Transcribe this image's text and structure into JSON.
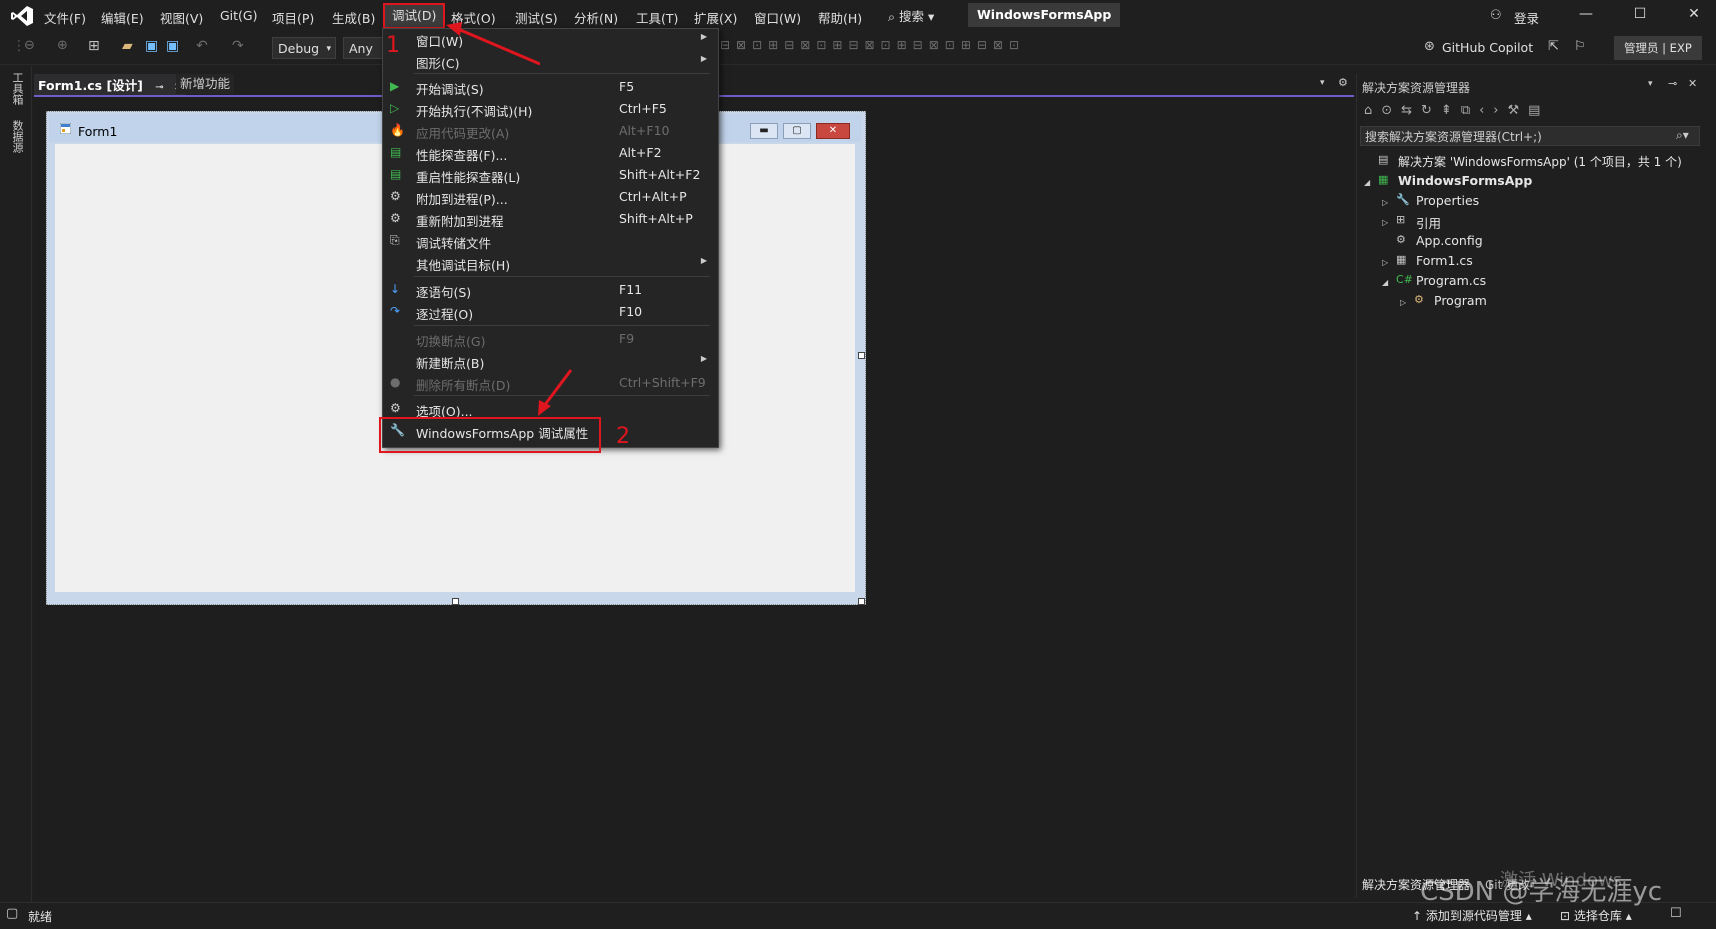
{
  "app": {
    "project_title": "WindowsFormsApp",
    "login_label": "登录",
    "search_label": "搜索"
  },
  "menu": {
    "items": [
      "文件(F)",
      "编辑(E)",
      "视图(V)",
      "Git(G)",
      "项目(P)",
      "生成(B)",
      "调试(D)",
      "格式(O)",
      "测试(S)",
      "分析(N)",
      "工具(T)",
      "扩展(X)",
      "窗口(W)",
      "帮助(H)"
    ],
    "active_item": "调试(D)"
  },
  "toolbar": {
    "config_combo": "Debug",
    "platform_combo": "Any C",
    "copilot_label": "GitHub Copilot",
    "admin_badge": "管理员 | EXP"
  },
  "left_bar": {
    "toolbox_label": "工具箱",
    "datasource_label": "数据源"
  },
  "tabs": {
    "active": "Form1.cs [设计]",
    "pin_glyph": "⊸",
    "close_glyph": "✕",
    "other": "新增功能"
  },
  "form": {
    "title": "Form1"
  },
  "debug_menu": {
    "items": [
      {
        "label": "窗口(W)",
        "shortcut": "",
        "submenu": true,
        "disabled": false,
        "icon": "none"
      },
      {
        "label": "图形(C)",
        "shortcut": "",
        "submenu": true,
        "disabled": false,
        "icon": "none"
      },
      {
        "label": "开始调试(S)",
        "shortcut": "F5",
        "submenu": false,
        "disabled": false,
        "icon": "play-filled-icon"
      },
      {
        "label": "开始执行(不调试)(H)",
        "shortcut": "Ctrl+F5",
        "submenu": false,
        "disabled": false,
        "icon": "play-outline-icon"
      },
      {
        "label": "应用代码更改(A)",
        "shortcut": "Alt+F10",
        "submenu": false,
        "disabled": true,
        "icon": "flame-icon"
      },
      {
        "label": "性能探查器(F)...",
        "shortcut": "Alt+F2",
        "submenu": false,
        "disabled": false,
        "icon": "performance-icon"
      },
      {
        "label": "重启性能探查器(L)",
        "shortcut": "Shift+Alt+F2",
        "submenu": false,
        "disabled": false,
        "icon": "performance-restart-icon"
      },
      {
        "label": "附加到进程(P)...",
        "shortcut": "Ctrl+Alt+P",
        "submenu": false,
        "disabled": false,
        "icon": "attach-icon"
      },
      {
        "label": "重新附加到进程",
        "shortcut": "Shift+Alt+P",
        "submenu": false,
        "disabled": false,
        "icon": "reattach-icon"
      },
      {
        "label": "调试转储文件",
        "shortcut": "",
        "submenu": false,
        "disabled": false,
        "icon": "dump-icon"
      },
      {
        "label": "其他调试目标(H)",
        "shortcut": "",
        "submenu": true,
        "disabled": false,
        "icon": "none"
      },
      {
        "label": "逐语句(S)",
        "shortcut": "F11",
        "submenu": false,
        "disabled": false,
        "icon": "step-into-icon"
      },
      {
        "label": "逐过程(O)",
        "shortcut": "F10",
        "submenu": false,
        "disabled": false,
        "icon": "step-over-icon"
      },
      {
        "label": "切换断点(G)",
        "shortcut": "F9",
        "submenu": false,
        "disabled": true,
        "icon": "none"
      },
      {
        "label": "新建断点(B)",
        "shortcut": "",
        "submenu": true,
        "disabled": false,
        "icon": "none"
      },
      {
        "label": "删除所有断点(D)",
        "shortcut": "Ctrl+Shift+F9",
        "submenu": false,
        "disabled": true,
        "icon": "breakpoints-icon"
      },
      {
        "label": "选项(O)...",
        "shortcut": "",
        "submenu": false,
        "disabled": false,
        "icon": "gear-icon"
      },
      {
        "label": "WindowsFormsApp 调试属性",
        "shortcut": "",
        "submenu": false,
        "disabled": false,
        "icon": "wrench-icon"
      }
    ]
  },
  "annotations": {
    "one": "1",
    "two": "2"
  },
  "solution_explorer": {
    "title": "解决方案资源管理器",
    "search_placeholder": "搜索解决方案资源管理器(Ctrl+;)",
    "tree": [
      {
        "label": "解决方案 'WindowsFormsApp' (1 个项目，共 1 个)",
        "level": 0,
        "expander": "",
        "bold": false
      },
      {
        "label": "WindowsFormsApp",
        "level": 0,
        "expander": "◢",
        "bold": true
      },
      {
        "label": "Properties",
        "level": 1,
        "expander": "▷",
        "bold": false
      },
      {
        "label": "引用",
        "level": 1,
        "expander": "▷",
        "bold": false
      },
      {
        "label": "App.config",
        "level": 1,
        "expander": "",
        "bold": false
      },
      {
        "label": "Form1.cs",
        "level": 1,
        "expander": "▷",
        "bold": false
      },
      {
        "label": "Program.cs",
        "level": 1,
        "expander": "◢",
        "bold": false
      },
      {
        "label": "Program",
        "level": 2,
        "expander": "▷",
        "bold": false
      }
    ],
    "bottom_tab": "解决方案资源管理器",
    "bottom_tab_2": "Git 更改"
  },
  "status": {
    "ready": "就绪",
    "add_source_control": "添加到源代码管理",
    "select_repo": "选择仓库"
  },
  "watermark": {
    "activate_windows": "激活 Windows",
    "csdn": "CSDN @学海无涯yc"
  }
}
